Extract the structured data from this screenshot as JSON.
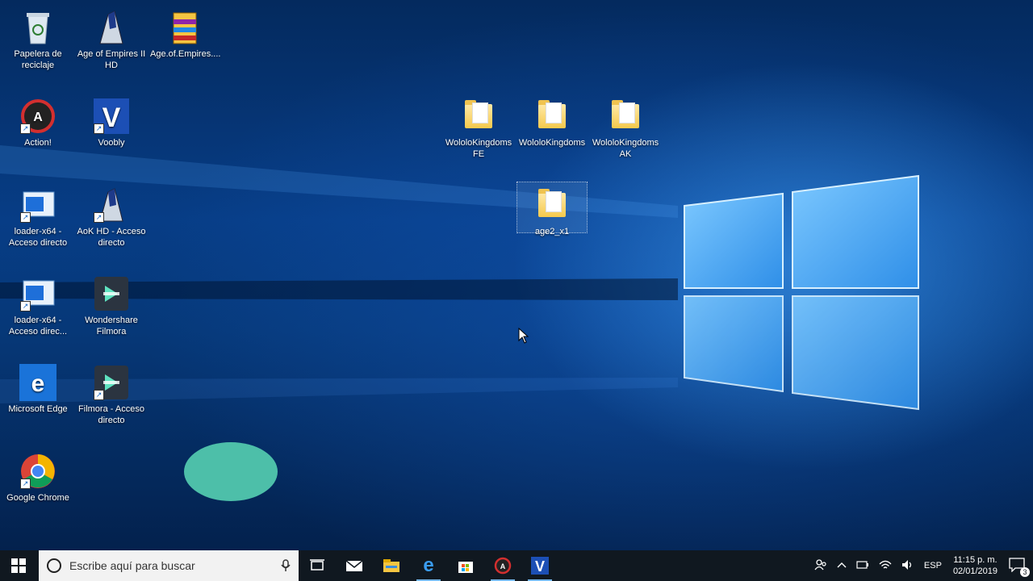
{
  "desktop": {
    "icons": [
      {
        "label": "Papelera de reciclaje",
        "icon": "recycle-bin-icon"
      },
      {
        "label": "Age of Empires II HD",
        "icon": "aoe-helmet-icon"
      },
      {
        "label": "Age.of.Empires....",
        "icon": "winrar-archive-icon"
      },
      {
        "label": "Action!",
        "icon": "action-recorder-icon"
      },
      {
        "label": "Voobly",
        "icon": "voobly-icon"
      },
      {
        "label": "loader-x64 - Acceso directo",
        "icon": "app-window-icon"
      },
      {
        "label": "AoK HD - Acceso directo",
        "icon": "aoe-helmet-icon"
      },
      {
        "label": "loader-x64 - Acceso direc...",
        "icon": "app-window-icon"
      },
      {
        "label": "Wondershare Filmora",
        "icon": "filmora-icon"
      },
      {
        "label": "Microsoft Edge",
        "icon": "edge-icon"
      },
      {
        "label": "Filmora - Acceso directo",
        "icon": "filmora-icon"
      },
      {
        "label": "Google Chrome",
        "icon": "chrome-icon"
      },
      {
        "label": "WololoKingdoms FE",
        "icon": "folder-icon"
      },
      {
        "label": "WololoKingdoms",
        "icon": "folder-icon"
      },
      {
        "label": "WololoKingdoms AK",
        "icon": "folder-icon"
      },
      {
        "label": "age2_x1",
        "icon": "folder-icon"
      }
    ]
  },
  "taskbar": {
    "search_placeholder": "Escribe aquí para buscar",
    "pinned": [
      "task-view-icon",
      "mail-icon",
      "file-explorer-icon",
      "edge-icon",
      "store-icon",
      "action-icon",
      "voobly-icon"
    ],
    "language": "ESP",
    "time": "11:15 p. m.",
    "date": "02/01/2019",
    "notification_count": "3"
  },
  "colors": {
    "taskbar": "#101820",
    "accent": "#76b9ed",
    "blob": "#4dbfa9"
  }
}
